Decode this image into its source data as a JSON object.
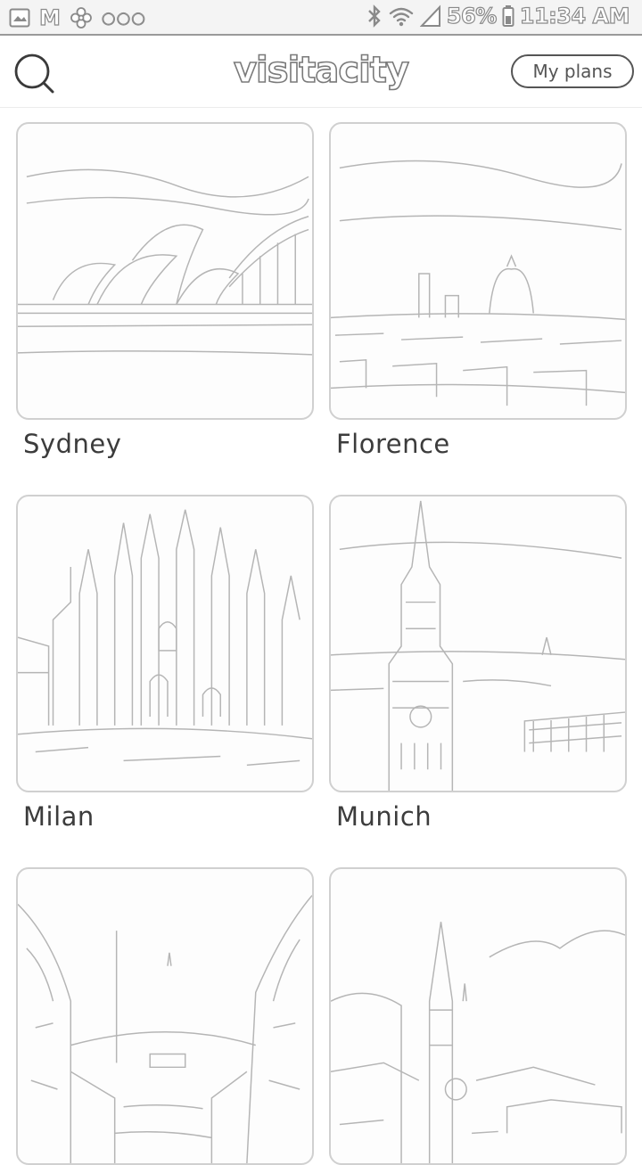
{
  "status_bar": {
    "battery": "56%",
    "time": "11:34 AM",
    "left_icons": [
      "gallery-icon",
      "gmail-icon",
      "fan-icon",
      "more-dots-icon"
    ],
    "right_icons": [
      "bluetooth-icon",
      "wifi-icon",
      "signal-icon",
      "battery-icon"
    ]
  },
  "header": {
    "logo": "visitacity",
    "my_plans_label": "My plans",
    "search_icon": "search-icon"
  },
  "cities": [
    {
      "name": "Sydney"
    },
    {
      "name": "Florence"
    },
    {
      "name": "Milan"
    },
    {
      "name": "Munich"
    },
    {
      "name": ""
    },
    {
      "name": ""
    }
  ],
  "colors": {
    "background": "#ffffff",
    "text": "#3c3c3c",
    "border": "#d0d0d0"
  }
}
